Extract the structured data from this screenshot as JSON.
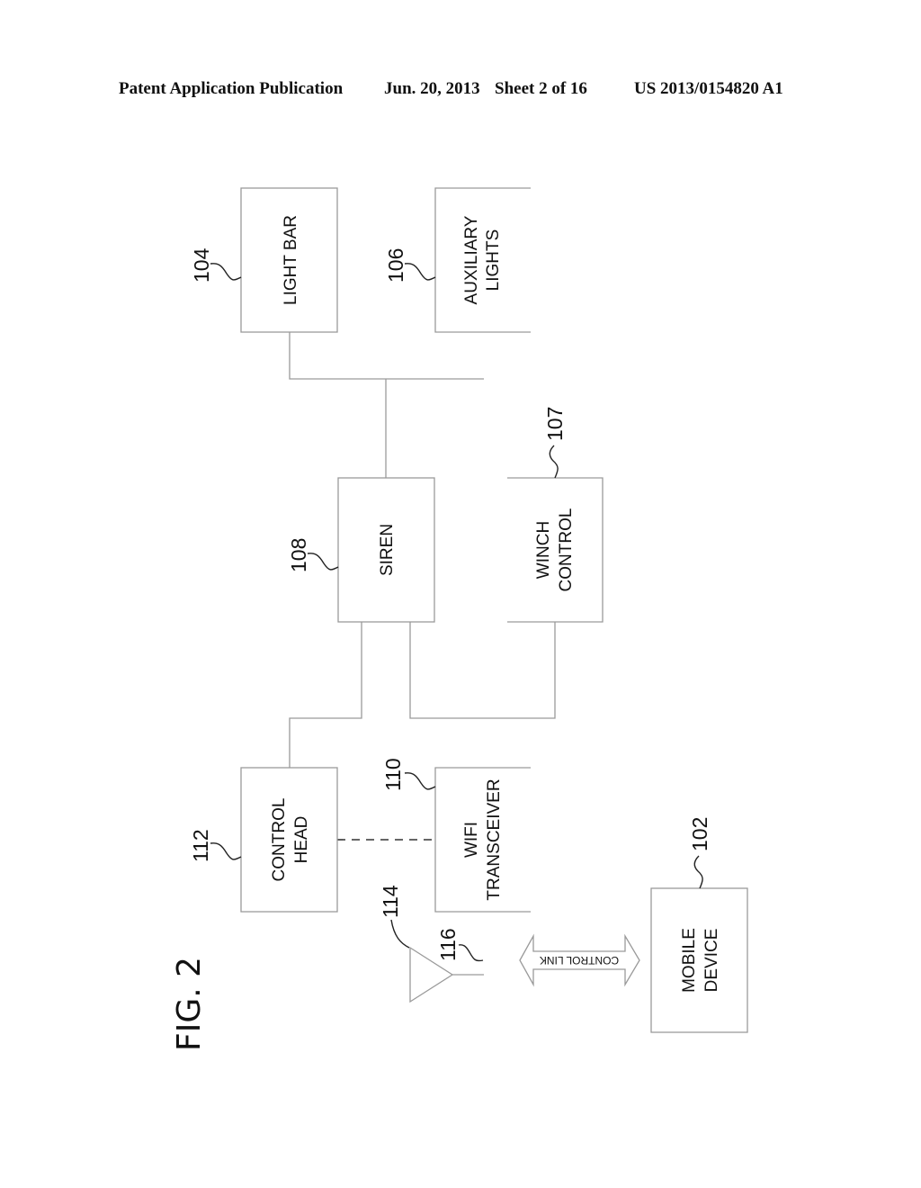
{
  "header": {
    "publication": "Patent Application Publication",
    "date": "Jun. 20, 2013",
    "sheet": "Sheet 2 of 16",
    "number": "US 2013/0154820 A1"
  },
  "figure": {
    "label": "FIG. 2",
    "blocks": {
      "light_bar": {
        "ref": "104",
        "lines": [
          "LIGHT BAR"
        ]
      },
      "auxiliary_lights": {
        "ref": "106",
        "lines": [
          "AUXILIARY",
          "LIGHTS"
        ]
      },
      "siren": {
        "ref": "108",
        "lines": [
          "SIREN"
        ]
      },
      "winch_control": {
        "ref": "107",
        "lines": [
          "WINCH",
          "CONTROL"
        ]
      },
      "control_head": {
        "ref": "112",
        "lines": [
          "CONTROL",
          "HEAD"
        ]
      },
      "wifi_transceiver": {
        "ref": "110",
        "lines": [
          "WIFI",
          "TRANSCEIVER"
        ]
      },
      "mobile_device": {
        "ref": "102",
        "lines": [
          "MOBILE",
          "DEVICE"
        ]
      }
    },
    "antenna": {
      "ref": "114",
      "signal_ref": "116"
    },
    "control_link": {
      "label": "CONTROL LINK"
    }
  }
}
